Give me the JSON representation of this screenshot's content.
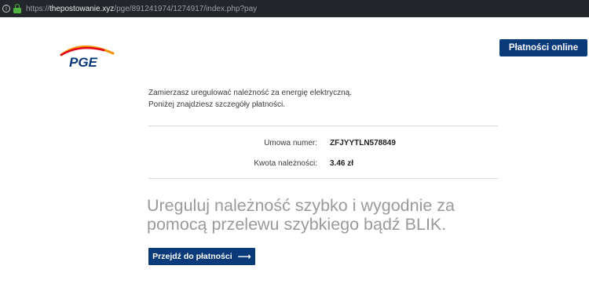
{
  "browser": {
    "url_protocol": "https://",
    "url_host": "thepostowanie.xyz",
    "url_path": "/pge/891241974/1274917/index.php?pay",
    "icons": [
      "info-icon",
      "lock-icon"
    ]
  },
  "header": {
    "logo_text": "PGE",
    "pay_online_label": "Płatności online"
  },
  "intro": {
    "line1": "Zamierzasz uregulować należność za energię elektryczną.",
    "line2": "Poniżej znajdziesz szczegóły płatności."
  },
  "details": {
    "contract_label": "Umowa numer:",
    "contract_value": "ZFJYYTLN578849",
    "amount_label": "Kwota należności:",
    "amount_value": "3.46 zł"
  },
  "headline": "Ureguluj należność szybko i wygodnie za pomocą przelewu szybkiego bądź BLIK.",
  "cta": {
    "label": "Przejdź do płatności",
    "icon": "arrow-right-icon"
  },
  "colors": {
    "brand_blue": "#0b3a7a",
    "logo_orange": "#f39200",
    "logo_red": "#e2001a"
  }
}
